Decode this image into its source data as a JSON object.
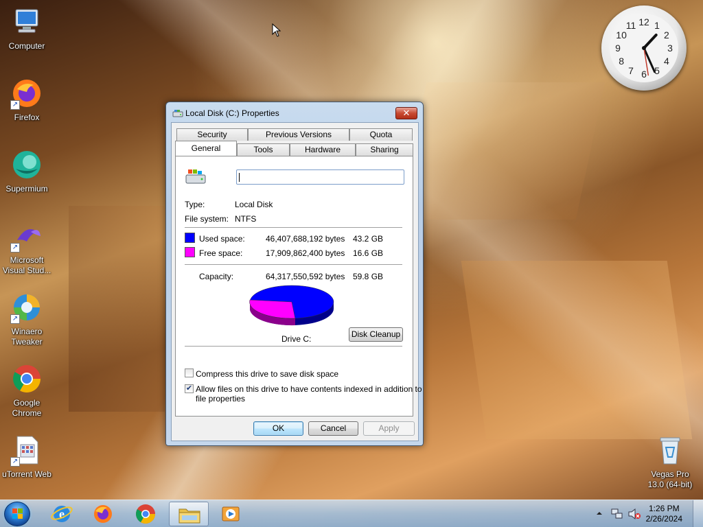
{
  "desktop": {
    "icons": [
      {
        "label": "Computer"
      },
      {
        "label": "Firefox"
      },
      {
        "label": "Supermium"
      },
      {
        "label": "Microsoft Visual Stud..."
      },
      {
        "label": "Winaero Tweaker"
      },
      {
        "label": "Google Chrome"
      },
      {
        "label": "uTorrent Web"
      },
      {
        "label": "Vegas Pro 13.0 (64-bit)"
      }
    ]
  },
  "clock": {
    "numerals": [
      "12",
      "1",
      "2",
      "3",
      "4",
      "5",
      "6",
      "7",
      "8",
      "9",
      "10",
      "11"
    ],
    "hour": 1,
    "minute": 26
  },
  "dialog": {
    "title": "Local Disk (C:) Properties",
    "close_label": "✕",
    "tabs_row1": [
      "Security",
      "Previous Versions",
      "Quota"
    ],
    "tabs_row2": [
      "General",
      "Tools",
      "Hardware",
      "Sharing"
    ],
    "active_tab": "General",
    "name_value": "",
    "type_label": "Type:",
    "type_value": "Local Disk",
    "fs_label": "File system:",
    "fs_value": "NTFS",
    "used_label": "Used space:",
    "used_bytes": "46,407,688,192 bytes",
    "used_gb": "43.2 GB",
    "free_label": "Free space:",
    "free_bytes": "17,909,862,400 bytes",
    "free_gb": "16.6 GB",
    "capacity_label": "Capacity:",
    "capacity_bytes": "64,317,550,592 bytes",
    "capacity_gb": "59.8 GB",
    "drive_label": "Drive C:",
    "cleanup_label": "Disk Cleanup",
    "compress_label": "Compress this drive to save disk space",
    "compress_checked": false,
    "index_label_1": "Allow files on this drive to have contents indexed in addition to",
    "index_label_2": "file properties",
    "index_checked": true,
    "ok_label": "OK",
    "cancel_label": "Cancel",
    "apply_label": "Apply",
    "used_color": "#0000ff",
    "free_color": "#ff00ff",
    "used_fraction": 0.7215
  },
  "taskbar": {
    "time": "1:26 PM",
    "date": "2/26/2024",
    "pinned": [
      "start-orb",
      "internet-explorer-icon",
      "firefox-icon",
      "chrome-icon",
      "file-explorer-icon",
      "media-player-icon"
    ]
  }
}
